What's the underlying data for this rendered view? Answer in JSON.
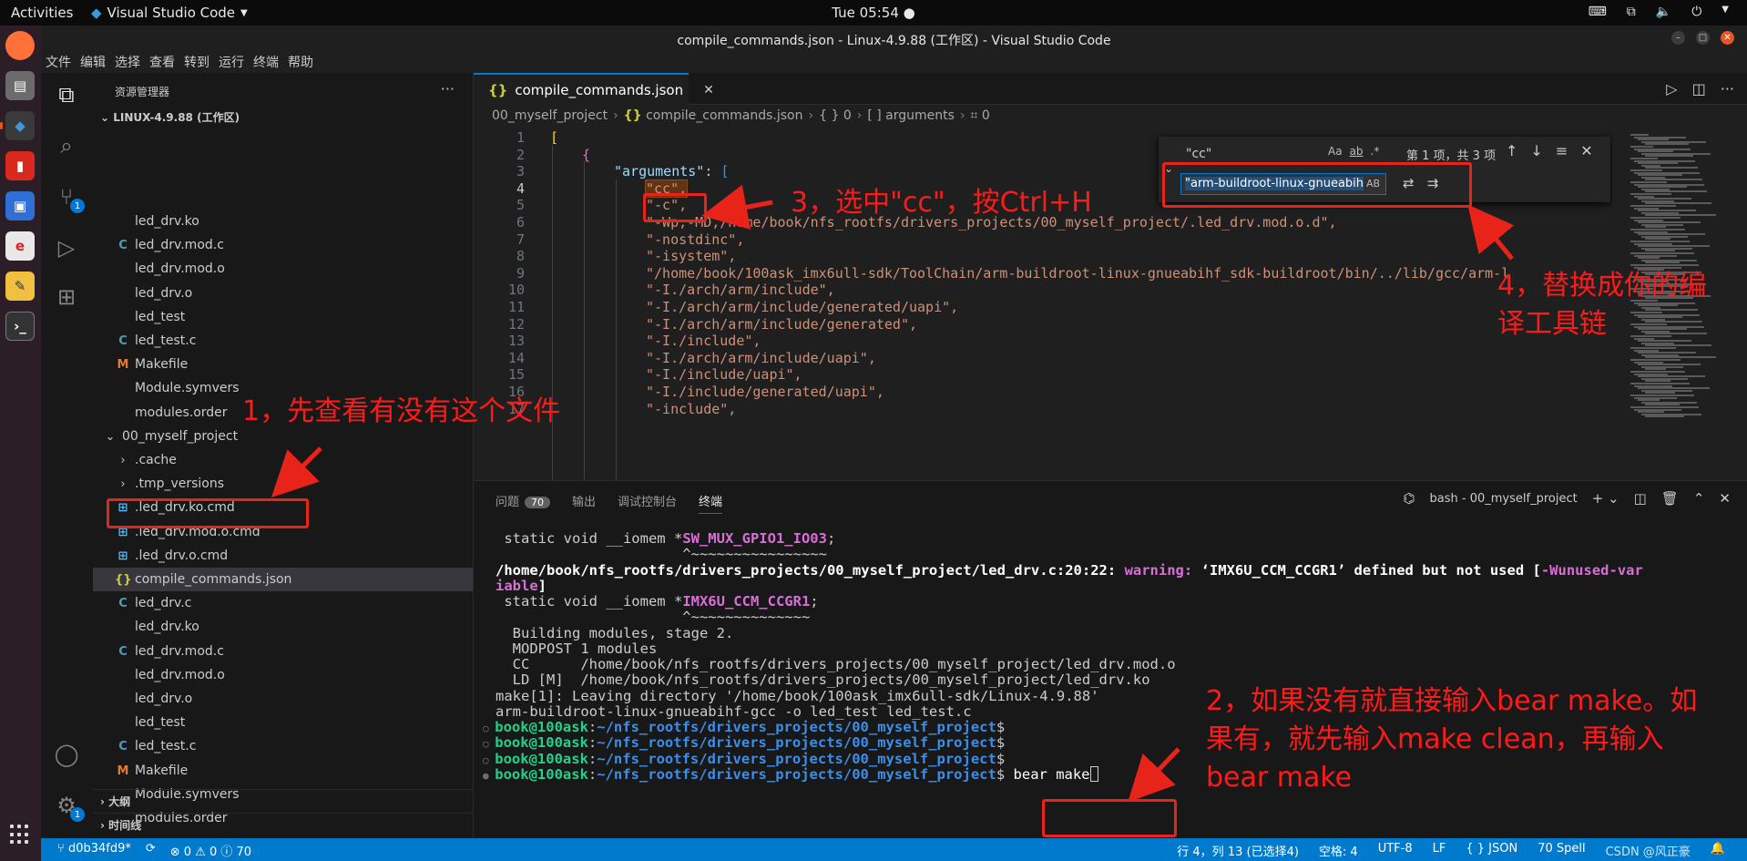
{
  "topbar": {
    "activities": "Activities",
    "app_name": "Visual Studio Code",
    "clock": "Tue 05:54"
  },
  "window": {
    "title": "compile_commands.json - Linux-4.9.88 (工作区) - Visual Studio Code"
  },
  "menu": [
    "文件",
    "编辑",
    "选择",
    "查看",
    "转到",
    "运行",
    "终端",
    "帮助"
  ],
  "activitybar": {
    "scm_badge": "1",
    "settings_badge": "1"
  },
  "explorer": {
    "title": "资源管理器",
    "root": "LINUX-4.9.88 (工作区)",
    "items": [
      {
        "label": "led_drv.ko",
        "icon": "none"
      },
      {
        "label": "led_drv.mod.c",
        "icon": "C"
      },
      {
        "label": "led_drv.mod.o",
        "icon": "none"
      },
      {
        "label": "led_drv.o",
        "icon": "none"
      },
      {
        "label": "led_test",
        "icon": "none"
      },
      {
        "label": "led_test.c",
        "icon": "C"
      },
      {
        "label": "Makefile",
        "icon": "M"
      },
      {
        "label": "Module.symvers",
        "icon": "none"
      },
      {
        "label": "modules.order",
        "icon": "none"
      },
      {
        "label": "00_myself_project",
        "icon": "chevron-down"
      },
      {
        "label": ".cache",
        "icon": "chevron-right"
      },
      {
        "label": ".tmp_versions",
        "icon": "chevron-right"
      },
      {
        "label": ".led_drv.ko.cmd",
        "icon": "windows"
      },
      {
        "label": ".led_drv.mod.o.cmd",
        "icon": "windows"
      },
      {
        "label": ".led_drv.o.cmd",
        "icon": "windows"
      },
      {
        "label": "compile_commands.json",
        "icon": "{}"
      },
      {
        "label": "led_drv.c",
        "icon": "C"
      },
      {
        "label": "led_drv.ko",
        "icon": "none"
      },
      {
        "label": "led_drv.mod.c",
        "icon": "C"
      },
      {
        "label": "led_drv.mod.o",
        "icon": "none"
      },
      {
        "label": "led_drv.o",
        "icon": "none"
      },
      {
        "label": "led_test",
        "icon": "none"
      },
      {
        "label": "led_test.c",
        "icon": "C"
      },
      {
        "label": "Makefile",
        "icon": "M"
      },
      {
        "label": "Module.symvers",
        "icon": "none"
      },
      {
        "label": "modules.order",
        "icon": "none"
      }
    ],
    "outline": "大纲",
    "timeline": "时间线"
  },
  "editor": {
    "tab": "compile_commands.json",
    "breadcrumb": [
      "00_myself_project",
      "compile_commands.json",
      "{ } 0",
      "[ ] arguments",
      "0"
    ],
    "line_numbers": [
      "1",
      "2",
      "3",
      "4",
      "5",
      "6",
      "7",
      "8",
      "9",
      "10",
      "11",
      "12",
      "13",
      "14",
      "15",
      "16",
      "17"
    ],
    "lines": [
      "[",
      "{",
      "\"arguments\": [",
      "\"cc\",",
      "\"-c\",",
      "\"-Wp,-MD,/home/book/nfs_rootfs/drivers_projects/00_myself_project/.led_drv.mod.o.d\",",
      "\"-nostdinc\",",
      "\"-isystem\",",
      "\"/home/book/100ask_imx6ull-sdk/ToolChain/arm-buildroot-linux-gnueabihf_sdk-buildroot/bin/../lib/gcc/arm-l",
      "\"-I./arch/arm/include\",",
      "\"-I./arch/arm/include/generated/uapi\",",
      "\"-I./arch/arm/include/generated\",",
      "\"-I./include\",",
      "\"-I./arch/arm/include/uapi\",",
      "\"-I./include/uapi\",",
      "\"-I./include/generated/uapi\",",
      "\"-include\","
    ]
  },
  "find": {
    "search": "\"cc\"",
    "count": "第 1 项，共 3 项",
    "replace": "\"arm-buildroot-linux-gnueabih",
    "opt_case": "Aa",
    "opt_word": "ab",
    "opt_regex": ".*",
    "preserve_case": "AB"
  },
  "panel": {
    "tabs": [
      "问题",
      "输出",
      "调试控制台",
      "终端"
    ],
    "problems_count": "70",
    "shell": "bash - 00_myself_project"
  },
  "terminal": {
    "l1a": " static void __iomem *",
    "l1b": "SW_MUX_GPIO1_IO03",
    "l1c": ";",
    "l2": "                      ^~~~~~~~~~~~~~~~~",
    "l3a": "/home/book/nfs_rootfs/drivers_projects/00_myself_project/led_drv.c:20:22: ",
    "l3b": "warning: ",
    "l3c": "‘IMX6U_CCM_CCGR1’ defined but not used [",
    "l3d": "-Wunused-var",
    "l4": "iable",
    "l4b": "]",
    "l5a": " static void __iomem *",
    "l5b": "IMX6U_CCM_CCGR1",
    "l5c": ";",
    "l6": "                      ^~~~~~~~~~~~~~~",
    "l7": "  Building modules, stage 2.",
    "l8": "  MODPOST 1 modules",
    "l9": "  CC      /home/book/nfs_rootfs/drivers_projects/00_myself_project/led_drv.mod.o",
    "l10": "  LD [M]  /home/book/nfs_rootfs/drivers_projects/00_myself_project/led_drv.ko",
    "l11": "make[1]: Leaving directory '/home/book/100ask_imx6ull-sdk/Linux-4.9.88'",
    "l12": "arm-buildroot-linux-gnueabihf-gcc -o led_test led_test.c",
    "prompt_user": "book@100ask",
    "prompt_path": "~/nfs_rootfs/drivers_projects/00_myself_project",
    "command": "bear make"
  },
  "statusbar": {
    "branch": "d0b34fd9*",
    "problems": "⊗ 0 ⚠ 0 ⓘ 70",
    "position": "行 4，列 13 (已选择4)",
    "spaces": "空格: 4",
    "encoding": "UTF-8",
    "eol": "LF",
    "language": "{ } JSON",
    "spell": "70 Spell",
    "watermark": "CSDN @风正豪"
  },
  "annotations": {
    "step1": "1，先查看有没有这个文件",
    "step2_l1": "2，如果没有就直接输入bear make。如",
    "step2_l2": "果有，就先输入make clean，再输入",
    "step2_l3": "bear make",
    "step3": "3，选中\"cc\"，按Ctrl+H",
    "step4_l1": "4，替换成你的编",
    "step4_l2": "译工具链"
  },
  "colors": {
    "accent": "#007acc",
    "annotation": "#e8241a",
    "selection": "#37373d"
  }
}
